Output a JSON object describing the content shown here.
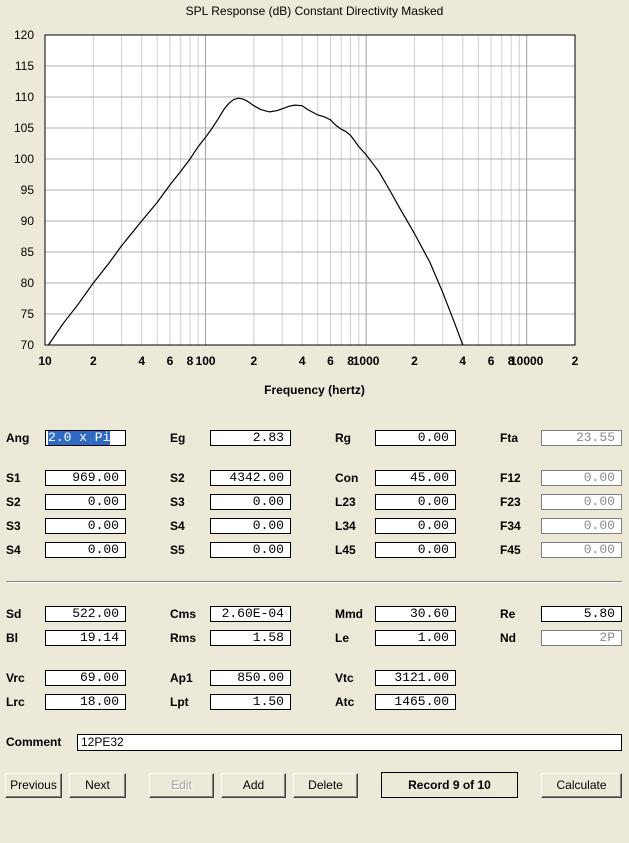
{
  "chart_data": {
    "type": "line",
    "title": "SPL Response (dB)   Constant Directivity   Masked",
    "xlabel": "Frequency (hertz)",
    "ylabel": "",
    "xscale": "log",
    "xlim": [
      10,
      20000
    ],
    "ylim": [
      70,
      120
    ],
    "yticks": [
      "120",
      "115",
      "110",
      "105",
      "100",
      "95",
      "90",
      "85",
      "80",
      "75",
      "70"
    ],
    "xticks": [
      {
        "f": 10,
        "label": "10"
      },
      {
        "f": 20,
        "label": "2"
      },
      {
        "f": 40,
        "label": "4"
      },
      {
        "f": 60,
        "label": "6"
      },
      {
        "f": 80,
        "label": "8"
      },
      {
        "f": 100,
        "label": "100"
      },
      {
        "f": 200,
        "label": "2"
      },
      {
        "f": 400,
        "label": "4"
      },
      {
        "f": 600,
        "label": "6"
      },
      {
        "f": 800,
        "label": "8"
      },
      {
        "f": 1000,
        "label": "1000"
      },
      {
        "f": 2000,
        "label": "2"
      },
      {
        "f": 4000,
        "label": "4"
      },
      {
        "f": 6000,
        "label": "6"
      },
      {
        "f": 8000,
        "label": "8"
      },
      {
        "f": 10000,
        "label": "10000"
      },
      {
        "f": 20000,
        "label": "2"
      }
    ],
    "grid": true,
    "series": [
      {
        "x": [
          10.5,
          13,
          16,
          20,
          25,
          30,
          40,
          50,
          60,
          70,
          80,
          90,
          100,
          110,
          120,
          130,
          140,
          150,
          160,
          170,
          180,
          190,
          200,
          220,
          250,
          280,
          300,
          330,
          360,
          400,
          430,
          460,
          500,
          550,
          600,
          650,
          700,
          750,
          800,
          900,
          1000,
          1200,
          1400,
          1600,
          2000,
          2500,
          3000,
          3500,
          4000
        ],
        "y": [
          70,
          73.5,
          76.5,
          80,
          83.2,
          86,
          90,
          93,
          95.8,
          98,
          100,
          102,
          103.5,
          105,
          106.5,
          108,
          109,
          109.6,
          109.8,
          109.7,
          109.4,
          109,
          108.6,
          108,
          107.6,
          107.8,
          108.1,
          108.5,
          108.7,
          108.6,
          108,
          107.6,
          107.1,
          106.8,
          106.3,
          105.4,
          104.8,
          104.4,
          103.8,
          102,
          100.7,
          98,
          95,
          92.3,
          88,
          83.3,
          78.5,
          74,
          70
        ]
      }
    ]
  },
  "fields": {
    "ang": "2.0 x Pi",
    "eg": "2.83",
    "rg": "0.00",
    "fta": "23.55",
    "s1a": "969.00",
    "s2b": "4342.00",
    "con": "45.00",
    "f12": "0.00",
    "s2a": "0.00",
    "s3b": "0.00",
    "l23": "0.00",
    "f23": "0.00",
    "s3a": "0.00",
    "s4b": "0.00",
    "l34": "0.00",
    "f34": "0.00",
    "s4a": "0.00",
    "s5b": "0.00",
    "l45": "0.00",
    "f45": "0.00",
    "sd": "522.00",
    "cms": "2.60E-04",
    "mmd": "30.60",
    "re": "5.80",
    "bl": "19.14",
    "rms": "1.58",
    "le": "1.00",
    "nd": "2P",
    "vrc": "69.00",
    "ap1": "850.00",
    "vtc": "3121.00",
    "lrc": "18.00",
    "lpt": "1.50",
    "atc": "1465.00",
    "comment": "12PE32"
  },
  "labels": {
    "ang": "Ang",
    "eg": "Eg",
    "rg": "Rg",
    "fta": "Fta",
    "s1a": "S1",
    "s2b": "S2",
    "con": "Con",
    "f12": "F12",
    "s2a": "S2",
    "s3b": "S3",
    "l23": "L23",
    "f23": "F23",
    "s3a": "S3",
    "s4b": "S4",
    "l34": "L34",
    "f34": "F34",
    "s4a": "S4",
    "s5b": "S5",
    "l45": "L45",
    "f45": "F45",
    "sd": "Sd",
    "cms": "Cms",
    "mmd": "Mmd",
    "re": "Re",
    "bl": "Bl",
    "rms": "Rms",
    "le": "Le",
    "nd": "Nd",
    "vrc": "Vrc",
    "ap1": "Ap1",
    "vtc": "Vtc",
    "lrc": "Lrc",
    "lpt": "Lpt",
    "atc": "Atc",
    "comment": "Comment"
  },
  "buttons": {
    "previous": "Previous",
    "next": "Next",
    "edit": "Edit",
    "add": "Add",
    "delete": "Delete",
    "calculate": "Calculate"
  },
  "record_status": "Record 9 of 10"
}
